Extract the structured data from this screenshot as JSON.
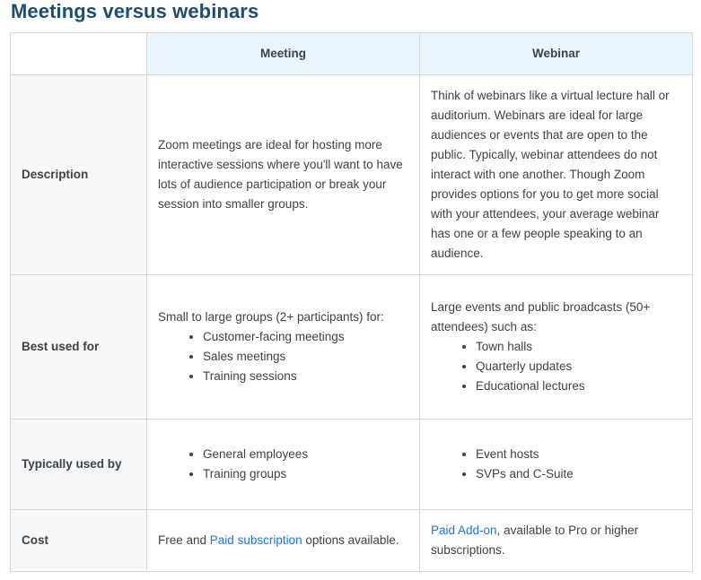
{
  "title": "Meetings versus webinars",
  "table": {
    "headers": {
      "meeting": "Meeting",
      "webinar": "Webinar"
    },
    "rows": {
      "description": {
        "label": "Description",
        "meeting": "Zoom meetings are ideal for hosting more interactive sessions where you'll want to have lots of audience participation or break your session into smaller groups.",
        "webinar": "Think of webinars like a virtual lecture hall or auditorium. Webinars are ideal for large audiences or events that are open to the public. Typically, webinar attendees do not interact with one another. Though Zoom provides options for you to get more social with your attendees, your average webinar has one or a few people speaking to an audience."
      },
      "best_used_for": {
        "label": "Best used for",
        "meeting_intro": "Small to large groups (2+ participants) for:",
        "meeting_items": [
          "Customer-facing meetings",
          "Sales meetings",
          "Training sessions"
        ],
        "webinar_intro": "Large events and public broadcasts (50+ attendees) such as:",
        "webinar_items": [
          "Town halls",
          "Quarterly updates",
          "Educational lectures"
        ]
      },
      "typically_used_by": {
        "label": "Typically used by",
        "meeting_items": [
          "General employees",
          "Training groups"
        ],
        "webinar_items": [
          "Event hosts",
          "SVPs and C-Suite"
        ]
      },
      "cost": {
        "label": "Cost",
        "meeting_prefix": "Free and ",
        "meeting_link": "Paid subscription",
        "meeting_suffix": " options available.",
        "webinar_link": "Paid Add-on",
        "webinar_suffix": ", available to Pro or higher subscriptions."
      }
    }
  },
  "colors": {
    "title": "#1d4e6e",
    "header_bg": "#e9f5fd",
    "rowhead_bg": "#f6f7f8",
    "border": "#d6d8da",
    "link": "#1b73e8"
  }
}
